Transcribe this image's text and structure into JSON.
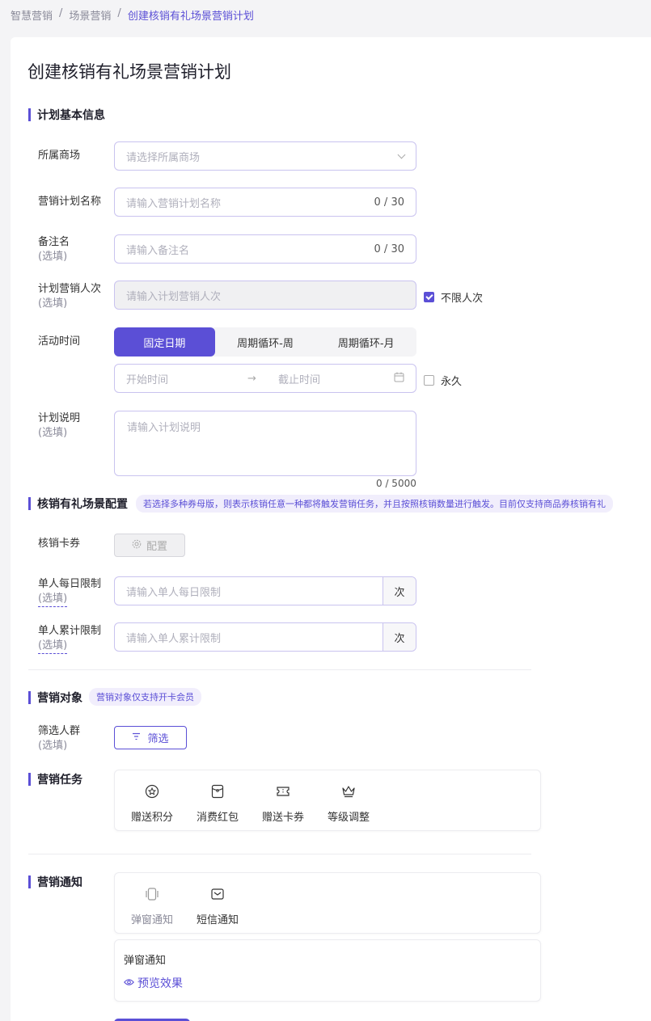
{
  "breadcrumb": {
    "item1": "智慧营销",
    "sep": "/",
    "item2": "场景营销",
    "current": "创建核销有礼场景营销计划"
  },
  "page": {
    "title": "创建核销有礼场景营销计划"
  },
  "basic": {
    "title": "计划基本信息",
    "mall": {
      "label": "所属商场",
      "placeholder": "请选择所属商场"
    },
    "name": {
      "label": "营销计划名称",
      "placeholder": "请输入营销计划名称",
      "counter": "0 / 30"
    },
    "remark": {
      "label": "备注名",
      "optional": "(选填)",
      "placeholder": "请输入备注名",
      "counter": "0 / 30"
    },
    "count": {
      "label": "计划营销人次",
      "optional": "(选填)",
      "placeholder": "请输入计划营销人次",
      "unlimited": "不限人次",
      "unlimited_checked": true
    },
    "time": {
      "label": "活动时间",
      "tabs": [
        "固定日期",
        "周期循环-周",
        "周期循环-月"
      ],
      "active_tab": 0,
      "start_placeholder": "开始时间",
      "arrow": "→",
      "end_placeholder": "截止时间",
      "forever": "永久",
      "forever_checked": false
    },
    "desc": {
      "label": "计划说明",
      "optional": "(选填)",
      "placeholder": "请输入计划说明",
      "counter": "0 / 5000"
    }
  },
  "scene": {
    "title": "核销有礼场景配置",
    "tag": "若选择多种券母版，则表示核销任意一种都将触发营销任务，并且按照核销数量进行触发。目前仅支持商品券核销有礼",
    "coupon": {
      "label": "核销卡券",
      "button": "配置"
    },
    "daily": {
      "label": "单人每日限制",
      "optional": "(选填)",
      "placeholder": "请输入单人每日限制",
      "unit": "次"
    },
    "total": {
      "label": "单人累计限制",
      "optional": "(选填)",
      "placeholder": "请输入单人累计限制",
      "unit": "次"
    }
  },
  "target": {
    "title": "营销对象",
    "tag": "营销对象仅支持开卡会员",
    "filter": {
      "label": "筛选人群",
      "optional": "(选填)",
      "button": "筛选"
    }
  },
  "task": {
    "title": "营销任务",
    "items": [
      {
        "label": "赠送积分",
        "icon": "points-icon"
      },
      {
        "label": "消费红包",
        "icon": "red-packet-icon"
      },
      {
        "label": "赠送卡券",
        "icon": "ticket-icon"
      },
      {
        "label": "等级调整",
        "icon": "crown-icon"
      }
    ]
  },
  "notify": {
    "title": "营销通知",
    "items": [
      {
        "label": "弹窗通知",
        "icon": "popup-icon"
      },
      {
        "label": "短信通知",
        "icon": "sms-icon"
      }
    ],
    "detail_title": "弹窗通知",
    "preview": "预览效果"
  },
  "colors": {
    "accent": "#5b4fd6",
    "border": "#c9c3ef"
  }
}
